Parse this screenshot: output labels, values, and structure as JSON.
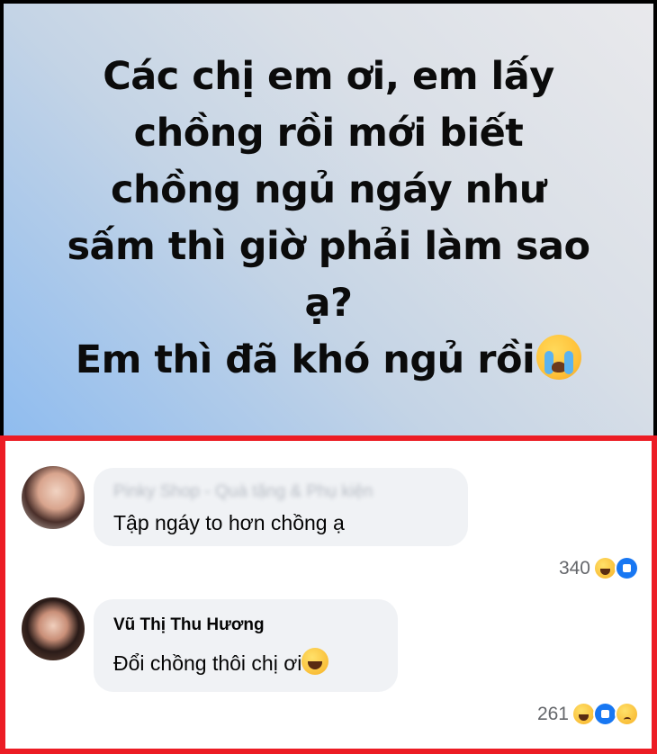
{
  "post": {
    "lines": [
      "Các chị em ơi, em lấy",
      "chồng rồi mới biết",
      "chồng ngủ ngáy như",
      "sấm thì giờ phải làm sao",
      "ạ?",
      "Em thì đã khó ngủ rồi"
    ],
    "trailing_emoji": "loudly-crying-face-icon"
  },
  "comments": [
    {
      "author": "Pinky Shop - Quà tặng & Phụ kiện",
      "author_blurred": true,
      "text": "Tập ngáy to hơn chồng ạ",
      "reaction_count": "340",
      "reactions": [
        "haha-icon",
        "like-icon"
      ]
    },
    {
      "author": "Vũ Thị Thu Hương",
      "author_blurred": false,
      "text": "Đổi chồng thôi chị ơi",
      "text_emoji": "tears-of-joy-icon",
      "reaction_count": "261",
      "reactions": [
        "haha-icon",
        "like-icon",
        "sad-icon"
      ]
    }
  ],
  "colors": {
    "highlight_border": "#ec1c24",
    "bubble_bg": "#f0f2f5",
    "like_blue": "#1877f2"
  }
}
